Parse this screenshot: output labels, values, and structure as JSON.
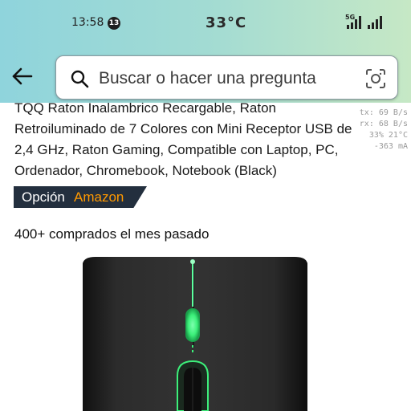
{
  "status_bar": {
    "time": "13:58",
    "notification_count": "13",
    "temperature": "33°C",
    "network_label": "5G"
  },
  "search": {
    "placeholder": "Buscar o hacer una pregunta",
    "back_icon": "arrow-left-icon",
    "search_icon": "magnifier-icon",
    "camera_icon": "camera-lens-icon"
  },
  "product": {
    "title": "TQQ Raton Inalambrico Recargable, Raton Retroiluminado de 7 Colores con Mini Receptor USB de 2,4 GHz, Raton Gaming, Compatible con Laptop, PC, Ordenador, Chromebook, Notebook (Black)",
    "choice_badge": {
      "prefix": "Opción",
      "brand": "Amazon"
    },
    "bought_text": "400+ comprados el mes pasado"
  },
  "debug_overlay": {
    "line1": "tx: 69 B/s",
    "line2": "rx: 68 B/s",
    "line3": "33%    21°C",
    "line4": "-363 mA"
  },
  "colors": {
    "badge_bg": "#232f3e",
    "badge_accent": "#ff9900",
    "mouse_glow": "#3cf07a"
  }
}
